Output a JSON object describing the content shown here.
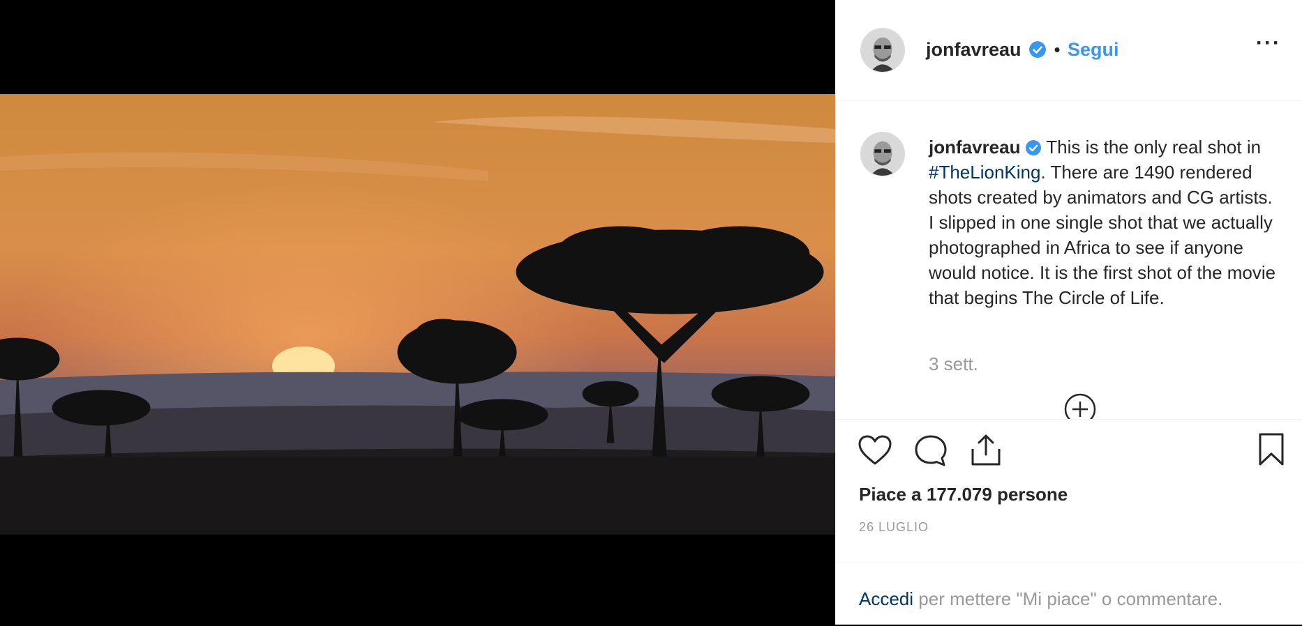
{
  "post": {
    "username": "jonfavreau",
    "separator": "•",
    "follow_label": "Segui",
    "more_label": "···"
  },
  "caption": {
    "username": "jonfavreau",
    "text_before": " This is the only real shot in ",
    "hashtag": "#TheLionKing",
    "text_after": ". There are 1490 rendered shots created by animators and CG artists. I slipped in one single shot that we actually photographed in Africa to see if anyone would notice. It is the first shot of the movie that begins The Circle of Life.",
    "time": "3 sett."
  },
  "stats": {
    "likes": "Piace a 177.079 persone",
    "date": "26 LUGLIO"
  },
  "login": {
    "link": "Accedi",
    "text": " per mettere \"Mi piace\" o commentare."
  },
  "colors": {
    "accent": "#3897f0",
    "link": "#003569",
    "text": "#262626",
    "muted": "#999999"
  },
  "icons": [
    "verified-badge-icon",
    "heart-icon",
    "comment-icon",
    "share-icon",
    "bookmark-icon",
    "add-icon",
    "more-icon"
  ]
}
